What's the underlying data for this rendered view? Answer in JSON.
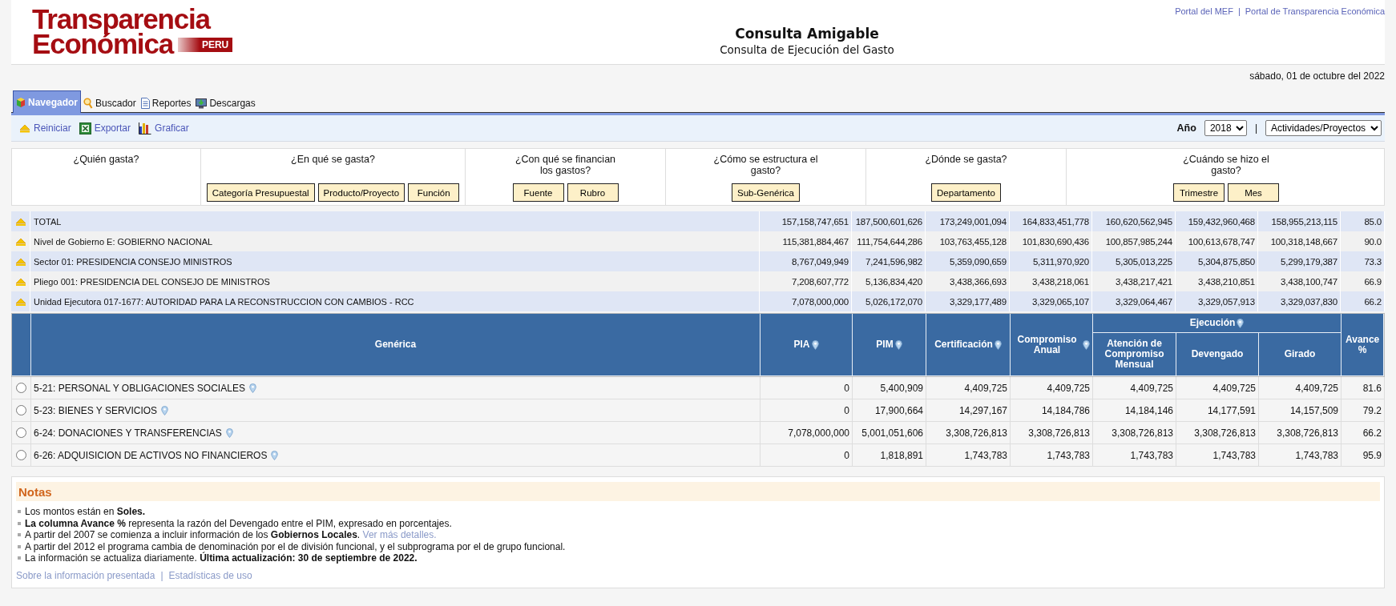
{
  "header": {
    "logo": {
      "line1": "Transparencia",
      "line2": "Económica",
      "badge": "PERU"
    },
    "title": "Consulta Amigable",
    "subtitle": "Consulta de Ejecución del Gasto",
    "links": [
      "Portal del MEF",
      "Portal de Transparencia Económica"
    ],
    "link_separator": "|",
    "date": "sábado, 01 de octubre del 2022"
  },
  "tabs": [
    {
      "label": "Navegador",
      "selected": true,
      "kind": "navigator"
    },
    {
      "label": "Buscador",
      "selected": false,
      "kind": "search"
    },
    {
      "label": "Reportes",
      "selected": false,
      "kind": "report"
    },
    {
      "label": "Descargas",
      "selected": false,
      "kind": "download"
    }
  ],
  "toolbar": {
    "actions": [
      {
        "label": "Reiniciar",
        "kind": "reset"
      },
      {
        "label": "Exportar",
        "kind": "excel"
      },
      {
        "label": "Graficar",
        "kind": "chart"
      }
    ],
    "year_label": "Año",
    "year": "2018",
    "separator": "|",
    "view": "Actividades/Proyectos"
  },
  "questions": [
    {
      "question": "¿Quién gasta?"
    },
    {
      "question": "¿En qué se gasta?",
      "buttons": [
        "Categoría Presupuestal",
        "Producto/Proyecto",
        "Función"
      ]
    },
    {
      "question": "¿Con qué se financian los gastos?",
      "buttons": [
        "Fuente",
        "Rubro"
      ]
    },
    {
      "question": "¿Cómo se estructura el gasto?",
      "buttons": [
        "Sub-Genérica"
      ]
    },
    {
      "question": "¿Dónde se gasta?",
      "buttons": [
        "Departamento"
      ]
    },
    {
      "question": "¿Cuándo se hizo el gasto?",
      "buttons": [
        "Trimestre",
        "Mes"
      ]
    }
  ],
  "summary": [
    {
      "label": "TOTAL",
      "values": [
        "157,158,747,651",
        "187,500,601,626",
        "173,249,001,094",
        "164,833,451,778",
        "160,620,562,945",
        "159,432,960,468",
        "158,955,213,115",
        "85.0"
      ]
    },
    {
      "label": "Nivel de Gobierno E: GOBIERNO NACIONAL",
      "values": [
        "115,381,884,467",
        "111,754,644,286",
        "103,763,455,128",
        "101,830,690,436",
        "100,857,985,244",
        "100,613,678,747",
        "100,318,148,667",
        "90.0"
      ]
    },
    {
      "label": "Sector 01: PRESIDENCIA CONSEJO MINISTROS",
      "values": [
        "8,767,049,949",
        "7,241,596,982",
        "5,359,090,659",
        "5,311,970,920",
        "5,305,013,225",
        "5,304,875,850",
        "5,299,179,387",
        "73.3"
      ]
    },
    {
      "label": "Pliego 001: PRESIDENCIA DEL CONSEJO DE MINISTROS",
      "values": [
        "7,208,607,772",
        "5,136,834,420",
        "3,438,366,693",
        "3,438,218,061",
        "3,438,217,421",
        "3,438,210,851",
        "3,438,100,747",
        "66.9"
      ]
    },
    {
      "label": "Unidad Ejecutora 017-1677: AUTORIDAD PARA LA RECONSTRUCCION CON CAMBIOS - RCC",
      "values": [
        "7,078,000,000",
        "5,026,172,070",
        "3,329,177,489",
        "3,329,065,107",
        "3,329,064,467",
        "3,329,057,913",
        "3,329,037,830",
        "66.2"
      ]
    }
  ],
  "table": {
    "columns": [
      {
        "label": "Genérica",
        "kind": "plain"
      },
      {
        "label": "PIA",
        "kind": "pin"
      },
      {
        "label": "PIM",
        "kind": "pin"
      },
      {
        "label": "Certificación",
        "kind": "pin"
      },
      {
        "label": "Compromiso Anual",
        "kind": "pin"
      },
      {
        "label": "Ejecución",
        "kind": "group",
        "children": [
          "Atención de Compromiso Mensual",
          "Devengado",
          "Girado"
        ]
      },
      {
        "label": "Avance %",
        "kind": "plain"
      }
    ],
    "rows": [
      {
        "label": "5-21: PERSONAL Y OBLIGACIONES SOCIALES",
        "selected": false,
        "values": [
          "0",
          "5,400,909",
          "4,409,725",
          "4,409,725",
          "4,409,725",
          "4,409,725",
          "4,409,725",
          "81.6"
        ]
      },
      {
        "label": "5-23: BIENES Y SERVICIOS",
        "selected": false,
        "values": [
          "0",
          "17,900,664",
          "14,297,167",
          "14,184,786",
          "14,184,146",
          "14,177,591",
          "14,157,509",
          "79.2"
        ]
      },
      {
        "label": "6-24: DONACIONES Y TRANSFERENCIAS",
        "selected": false,
        "values": [
          "7,078,000,000",
          "5,001,051,606",
          "3,308,726,813",
          "3,308,726,813",
          "3,308,726,813",
          "3,308,726,813",
          "3,308,726,813",
          "66.2"
        ]
      },
      {
        "label": "6-26: ADQUISICION DE ACTIVOS NO FINANCIEROS",
        "selected": false,
        "values": [
          "0",
          "1,818,891",
          "1,743,783",
          "1,743,783",
          "1,743,783",
          "1,743,783",
          "1,743,783",
          "95.9"
        ]
      }
    ]
  },
  "notes": {
    "title": "Notas",
    "items": [
      {
        "text": "Los montos están en **Soles.**"
      },
      {
        "text": "**La columna Avance %** representa la razón del Devengado entre el PIM, expresado en porcentajes."
      },
      {
        "text": "A partir del 2007 se comienza a incluir información de los **Gobiernos Locales**.",
        "link": "Ver más detalles."
      },
      {
        "text": "A partir del 2012 el programa cambia de denominación por el de división funcional, y el subprograma por el de grupo funcional."
      },
      {
        "text": "La información se actualiza diariamente. **Última actualización: 30 de septiembre de 2022.**"
      }
    ],
    "footer_links": [
      "Sobre la información presentada",
      "Estadísticas de uso"
    ],
    "separator": "|"
  }
}
